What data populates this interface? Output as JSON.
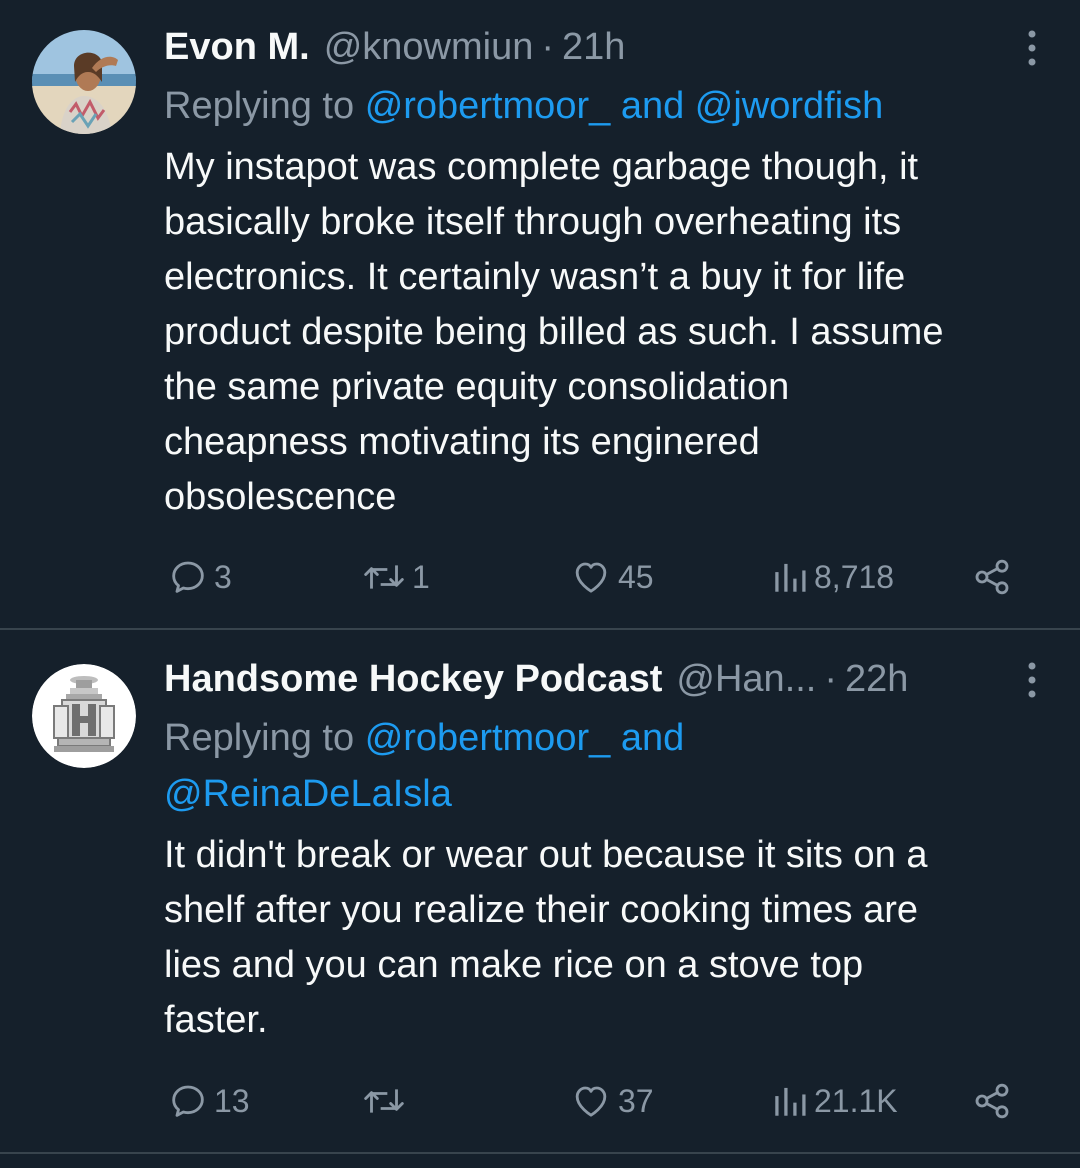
{
  "tweets": [
    {
      "display_name": "Evon M.",
      "handle": "@knowmiun",
      "time": "21h",
      "reply_prefix": "Replying to",
      "reply_mention_1": "@robertmoor_",
      "reply_and": "and",
      "reply_mention_2": "@jwordfish",
      "text": "My instapot was complete garbage though, it\nbasically broke itself through overheating its\nelectronics. It certainly wasn’t a buy it for life\nproduct despite being billed as such. I assume\nthe same private equity consolidation\ncheapness motivating its enginered\nobsolescence",
      "replies": "3",
      "reposts": "1",
      "likes": "45",
      "views": "8,718",
      "avatar_icon": "beach-portrait-avatar"
    },
    {
      "display_name": "Handsome Hockey Podcast",
      "handle": "@Han...",
      "time": "22h",
      "reply_prefix": "Replying to",
      "reply_mention_1": "@robertmoor_",
      "reply_and": "and",
      "reply_mention_2": "@ReinaDeLaIsla",
      "text": "It didn't break or wear out because it sits on a\nshelf after you realize their cooking times are\nlies and you can make rice on a stove top\nfaster.",
      "replies": "13",
      "reposts": "",
      "likes": "37",
      "views": "21.1K",
      "avatar_icon": "hockey-trophy-h-logo"
    }
  ],
  "separator": "·",
  "colors": {
    "background": "#15202b",
    "primary_text": "#f7f9f9",
    "secondary_text": "#8b98a5",
    "link": "#1d9bf0",
    "divider": "#38444d"
  },
  "icons": [
    "more-icon",
    "reply-icon",
    "repost-icon",
    "like-icon",
    "views-icon",
    "share-icon"
  ]
}
